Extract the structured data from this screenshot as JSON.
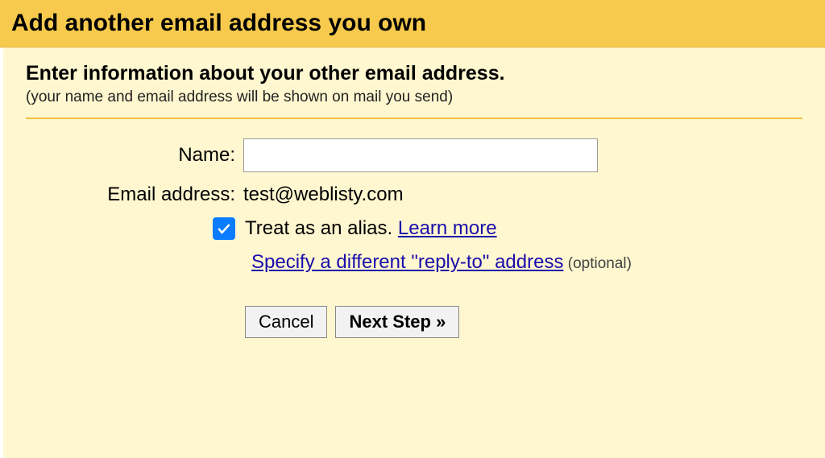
{
  "header": {
    "title": "Add another email address you own"
  },
  "section": {
    "title": "Enter information about your other email address.",
    "subtitle": "(your name and email address will be shown on mail you send)"
  },
  "form": {
    "name_label": "Name:",
    "name_value": "",
    "email_label": "Email address:",
    "email_value": "test@weblisty.com",
    "alias_label": "Treat as an alias. ",
    "learn_more": "Learn more",
    "alias_checked": true,
    "reply_to_link": "Specify a different \"reply-to\" address",
    "optional_text": " (optional)"
  },
  "buttons": {
    "cancel": "Cancel",
    "next": "Next Step »"
  }
}
